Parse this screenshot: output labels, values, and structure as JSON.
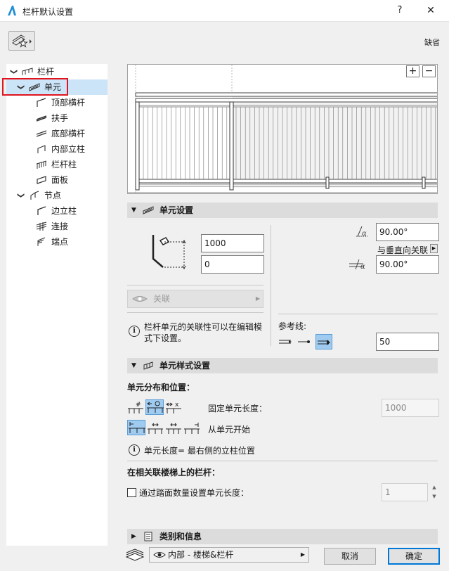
{
  "window": {
    "title": "栏杆默认设置",
    "help_label": "?",
    "close_label": "✕"
  },
  "header": {
    "default_label": "缺省"
  },
  "tree": {
    "items": [
      {
        "label": "栏杆"
      },
      {
        "label": "单元"
      },
      {
        "label": "顶部横杆"
      },
      {
        "label": "扶手"
      },
      {
        "label": "底部横杆"
      },
      {
        "label": "内部立柱"
      },
      {
        "label": "栏杆柱"
      },
      {
        "label": "面板"
      },
      {
        "label": "节点"
      },
      {
        "label": "边立柱"
      },
      {
        "label": "连接"
      },
      {
        "label": "端点"
      }
    ]
  },
  "preview": {
    "zoom_in": "+",
    "zoom_out": "−"
  },
  "segment_settings": {
    "title": "单元设置",
    "height_value": "1000",
    "offset_value": "0",
    "angle_value": "90.00°",
    "angle2_value": "90.00°",
    "perp_link_label": "与垂直向关联",
    "relate_button": "关联",
    "info_text_1": "栏杆单元的关联性可以在编辑模",
    "info_text_2": "式下设置。",
    "ref_line_label": "参考线:",
    "ref_value": "50"
  },
  "segment_pattern": {
    "title": "单元样式设置",
    "distribution_label": "单元分布和位置：",
    "fixed_length_label": "固定单元长度：",
    "fixed_length_value": "1000",
    "start_from_label": "从单元开始",
    "length_info": "单元长度= 最右侧的立柱位置",
    "stair_label": "在相关联楼梯上的栏杆：",
    "tread_checkbox_label": "通过踏面数量设置单元长度：",
    "tread_value": "1"
  },
  "classification": {
    "title": "类别和信息"
  },
  "footer": {
    "layer_value": "内部 - 楼梯&栏杆",
    "cancel_label": "取消",
    "ok_label": "确定"
  },
  "colors": {
    "selection": "#cce4f7",
    "highlight_border": "#e0141e",
    "active_tool": "#9fcbf1",
    "primary_border": "#0078d7"
  }
}
